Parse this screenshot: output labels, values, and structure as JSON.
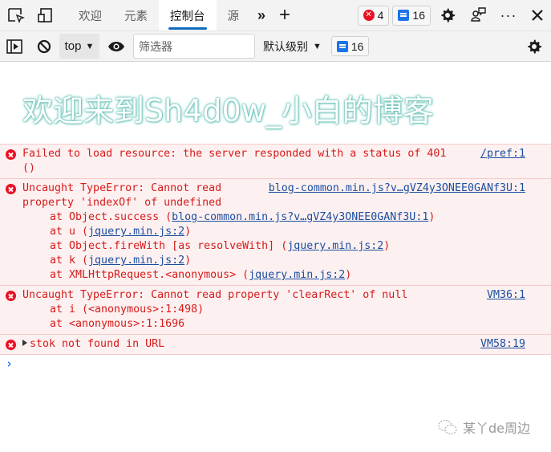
{
  "tabbar": {
    "tabs": [
      {
        "label": "欢迎",
        "active": false
      },
      {
        "label": "元素",
        "active": false
      },
      {
        "label": "控制台",
        "active": true
      },
      {
        "label": "源",
        "active": false
      }
    ],
    "more_tabs": "»",
    "add_tab": "+",
    "error_count": "4",
    "message_count": "16"
  },
  "toolbar": {
    "context": "top",
    "filter_placeholder": "筛选器",
    "levels_label": "默认级别",
    "issues_count": "16"
  },
  "banner": {
    "text": "欢迎来到Sh4d0w_小白的博客"
  },
  "console": {
    "entries": [
      {
        "message": "Failed to load resource: the server responded with a status of 401",
        "message_cont": "()",
        "source": "/pref:1"
      },
      {
        "message": "Uncaught TypeError: Cannot read",
        "message_cont": "property 'indexOf' of undefined",
        "source": "blog-common.min.js?v…gVZ4y3ONEE0GANf3U:1",
        "stack": [
          {
            "prefix": "at Object.success (",
            "link": "blog-common.min.js?v…gVZ4y3ONEE0GANf3U:1",
            "suffix": ")"
          },
          {
            "prefix": "at u (",
            "link": "jquery.min.js:2",
            "suffix": ")"
          },
          {
            "prefix": "at Object.fireWith [as resolveWith] (",
            "link": "jquery.min.js:2",
            "suffix": ")"
          },
          {
            "prefix": "at k (",
            "link": "jquery.min.js:2",
            "suffix": ")"
          },
          {
            "prefix": "at XMLHttpRequest.<anonymous> (",
            "link": "jquery.min.js:2",
            "suffix": ")"
          }
        ]
      },
      {
        "message": "Uncaught TypeError: Cannot read property 'clearRect' of null",
        "source": "VM36:1",
        "stack": [
          {
            "text": "at i (<anonymous>:1:498)"
          },
          {
            "text": "at <anonymous>:1:1696"
          }
        ]
      },
      {
        "message": "stok not found in URL",
        "source": "VM58:19"
      }
    ],
    "prompt": "›"
  },
  "watermark": {
    "text": "某丫de周边"
  }
}
